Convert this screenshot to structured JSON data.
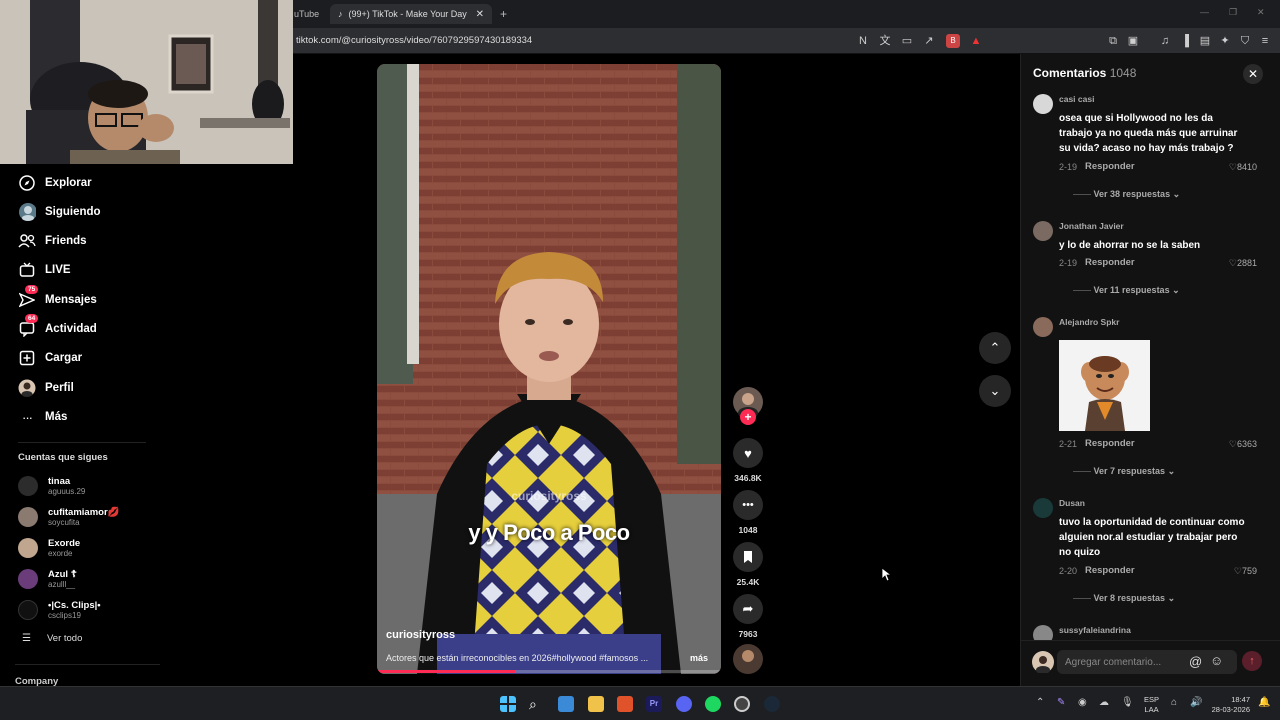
{
  "browser": {
    "prev_tab_fragment": "uTube",
    "active_tab_title": "(99+) TikTok - Make Your Day",
    "url": "tiktok.com/@curiosityross/video/7607929597430189334"
  },
  "nav": {
    "explore": "Explorar",
    "following": "Siguiendo",
    "friends": "Friends",
    "live": "LIVE",
    "messages": "Mensajes",
    "messages_badge": "75",
    "activity": "Actividad",
    "activity_badge": "64",
    "upload": "Cargar",
    "profile": "Perfil",
    "more": "Más",
    "following_accounts_title": "Cuentas que sigues",
    "accounts": [
      {
        "name": "tinaa",
        "user": "aguuus.29"
      },
      {
        "name": "cufitamiamor💋",
        "user": "soycufita"
      },
      {
        "name": "Exorde",
        "user": "exorde"
      },
      {
        "name": "Azul ☦",
        "user": "azulll__"
      },
      {
        "name": "•|Cs. Clips|•",
        "user": "csclips19"
      }
    ],
    "see_all": "Ver todo",
    "company": "Company"
  },
  "video": {
    "caption": "y y Poco a Poco",
    "watermark": "curiosityross",
    "author": "curiosityross",
    "description": "Actores que están irreconocibles en 2026#hollywood #famosos ...",
    "more": "más",
    "progress": 0.4
  },
  "actions": {
    "likes": "346.8K",
    "comments": "1048",
    "saves": "25.4K",
    "shares": "7963"
  },
  "comments_panel": {
    "title": "Comentarios",
    "count": "1048",
    "reply_label": "Responder",
    "input_placeholder": "Agregar comentario...",
    "items": [
      {
        "user": "casi casi",
        "text": "osea que si Hollywood no les da trabajo ya no queda más que arruinar su vida? acaso no hay más trabajo ?",
        "date": "2-19",
        "likes": "8410",
        "replies": "Ver 38 respuestas"
      },
      {
        "user": "Jonathan Javier",
        "text": "y lo de ahorrar no se la saben",
        "date": "2-19",
        "likes": "2881",
        "replies": "Ver 11 respuestas"
      },
      {
        "user": "Alejandro Spkr",
        "text": "",
        "date": "2-21",
        "likes": "6363",
        "replies": "Ver 7 respuestas"
      },
      {
        "user": "Dusan",
        "text": "tuvo la oportunidad de continuar como alguien nor.al estudiar y trabajar pero no quizo",
        "date": "2-20",
        "likes": "759",
        "replies": "Ver 8 respuestas"
      },
      {
        "user": "sussyfaleiandrina",
        "text": "",
        "date": "",
        "likes": "",
        "replies": ""
      }
    ]
  },
  "taskbar": {
    "lang": "ESP",
    "layout": "LAA",
    "time": "18:47",
    "date": "28-03-2026"
  },
  "colors": {
    "accent": "#fe2c55",
    "panel": "#121212",
    "background": "#000000"
  }
}
